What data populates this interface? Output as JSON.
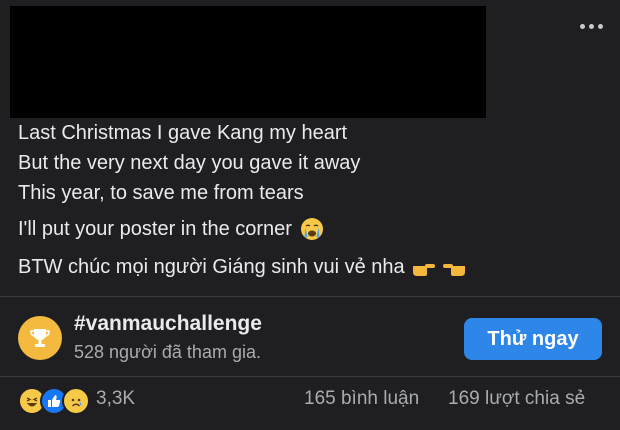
{
  "post": {
    "lines": [
      "Last Christmas I gave Kang my heart",
      "But the very next day you gave it away",
      "This year, to save me from tears",
      "I'll put your poster in the corner",
      "BTW chúc mọi người Giáng sinh vui vẻ nha"
    ],
    "icons": {
      "line4": "crying-face-icon",
      "line5": "pointing-hands-icon"
    }
  },
  "challenge": {
    "hashtag": "#vanmauchallenge",
    "participants": "528 người đã tham gia.",
    "button_label": "Thử ngay",
    "icon": "trophy-icon"
  },
  "reactions": {
    "icons": [
      "laugh-reaction-icon",
      "like-reaction-icon",
      "sad-reaction-icon"
    ],
    "count": "3,3K",
    "comments": "165 bình luận",
    "shares": "169 lượt chia sẻ"
  },
  "colors": {
    "background": "#1f1f21",
    "accent": "#2d86e8",
    "trophy": "#f4b93f"
  }
}
